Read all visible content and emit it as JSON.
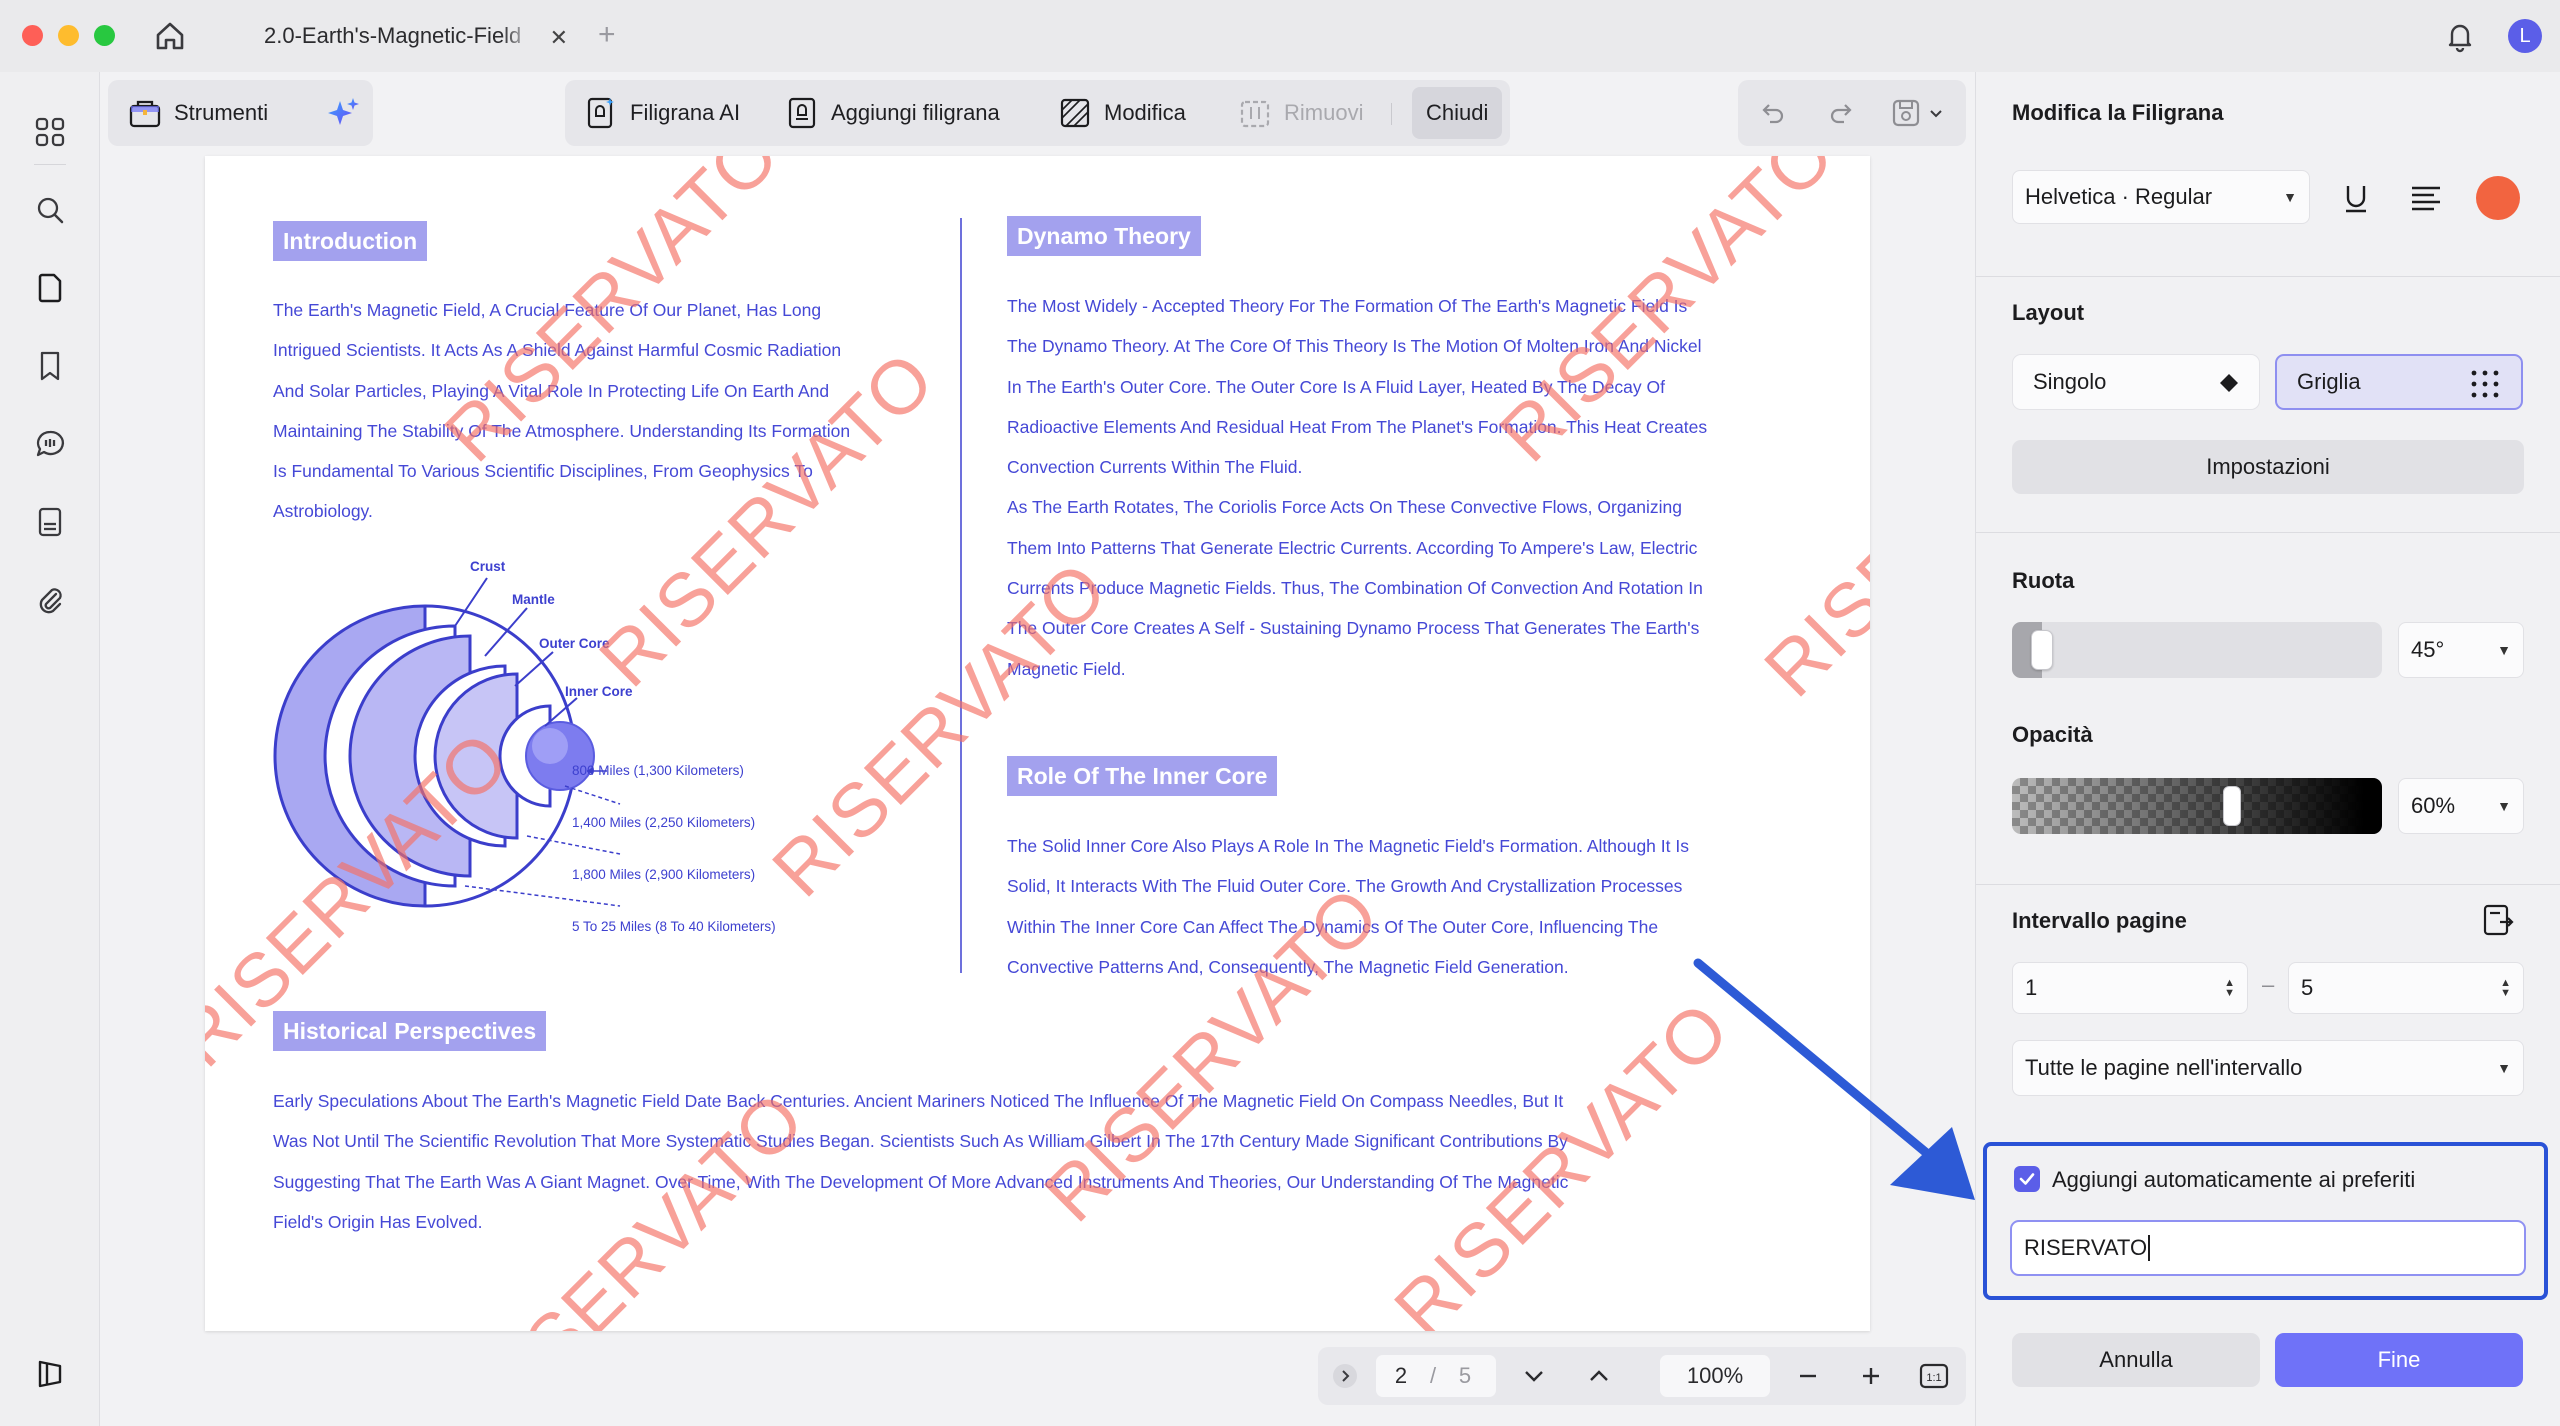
{
  "window": {
    "tab_title": "2.0-Earth's-Magnetic-Field",
    "tab_close": "✕",
    "tab_add": "+",
    "avatar_letter": "L"
  },
  "toolbar": {
    "tools_label": "Strumenti",
    "ai_watermark_label": "Filigrana AI",
    "add_watermark_label": "Aggiungi filigrana",
    "edit_label": "Modifica",
    "remove_label": "Rimuovi",
    "close_label": "Chiudi"
  },
  "document": {
    "watermark_text": "RISERVATO",
    "intro": {
      "heading": "Introduction",
      "lines": [
        "The Earth's Magnetic Field, A Crucial Feature Of Our Planet, Has Long",
        "Intrigued Scientists. It Acts As A Shield Against Harmful Cosmic Radiation",
        "And Solar Particles, Playing A Vital Role In Protecting Life On Earth And",
        "Maintaining The Stability Of The Atmosphere. Understanding Its Formation",
        "Is Fundamental To Various Scientific Disciplines, From Geophysics To",
        "Astrobiology."
      ]
    },
    "diagram": {
      "crust": "Crust",
      "mantle": "Mantle",
      "outer_core": "Outer Core",
      "inner_core": "Inner Core",
      "m1": "800 Miles (1,300 Kilometers)",
      "m2": "1,400 Miles (2,250 Kilometers)",
      "m3": "1,800 Miles (2,900 Kilometers)",
      "m4": "5 To 25 Miles (8 To 40 Kilometers)"
    },
    "dynamo": {
      "heading": "Dynamo Theory",
      "lines": [
        "The Most Widely - Accepted Theory For The Formation Of The Earth's Magnetic Field Is",
        "The Dynamo Theory. At The Core Of This Theory Is The Motion Of Molten Iron And Nickel",
        "In The Earth's Outer Core. The Outer Core Is A Fluid Layer, Heated By The Decay Of",
        "Radioactive Elements And Residual Heat From The Planet's Formation. This Heat Creates",
        "Convection Currents Within The Fluid.",
        "As The Earth Rotates, The Coriolis Force Acts On These Convective Flows, Organizing",
        "Them Into Patterns That Generate Electric Currents. According To Ampere's Law, Electric",
        "Currents Produce Magnetic Fields. Thus, The Combination Of Convection And Rotation In",
        "The Outer Core Creates A Self - Sustaining Dynamo Process That Generates The Earth's",
        "Magnetic Field."
      ]
    },
    "inner_core_role": {
      "heading": "Role Of The Inner Core",
      "lines": [
        "The Solid Inner Core Also Plays A Role In The Magnetic Field's Formation. Although It Is",
        "Solid, It Interacts With The Fluid Outer Core. The Growth And Crystallization Processes",
        "Within The Inner Core Can Affect The Dynamics Of The Outer Core, Influencing The",
        "Convective Patterns And, Consequently, The Magnetic Field Generation."
      ]
    },
    "history": {
      "heading": "Historical Perspectives",
      "lines": [
        "Early Speculations About The Earth's Magnetic Field Date Back Centuries. Ancient Mariners Noticed The Influence Of The Magnetic Field On Compass Needles, But It",
        "Was Not Until The Scientific Revolution That More Systematic Studies Began. Scientists Such As William Gilbert In The 17th Century Made Significant Contributions By",
        "Suggesting That The Earth Was A Giant Magnet. Over Time, With The Development Of More Advanced Instruments And Theories, Our Understanding Of The Magnetic",
        "Field's Origin Has Evolved."
      ]
    }
  },
  "pagenav": {
    "current_page": "2",
    "separator": "/",
    "total_pages": "5",
    "zoom": "100%"
  },
  "panel": {
    "title": "Modifica la Filigrana",
    "font_select": "Helvetica · Regular",
    "color": "#f26440",
    "layout_label": "Layout",
    "layout_single": "Singolo",
    "layout_grid": "Griglia",
    "layout_selected": "Griglia",
    "settings_button": "Impostazioni",
    "rotate_label": "Ruota",
    "rotate_value": "45°",
    "rotate_fraction": 0.04,
    "opacity_label": "Opacità",
    "opacity_value": "60%",
    "opacity_fraction": 0.6,
    "page_range_label": "Intervallo pagine",
    "range_from": "1",
    "range_dash": "–",
    "range_to": "5",
    "range_mode": "Tutte le pagine nell'intervallo",
    "favorites_label": "Aggiungi automaticamente ai preferiti",
    "favorites_checked": true,
    "watermark_input": "RISERVATO",
    "cancel_button": "Annulla",
    "done_button": "Fine",
    "highlight_color": "#2a52d6"
  }
}
